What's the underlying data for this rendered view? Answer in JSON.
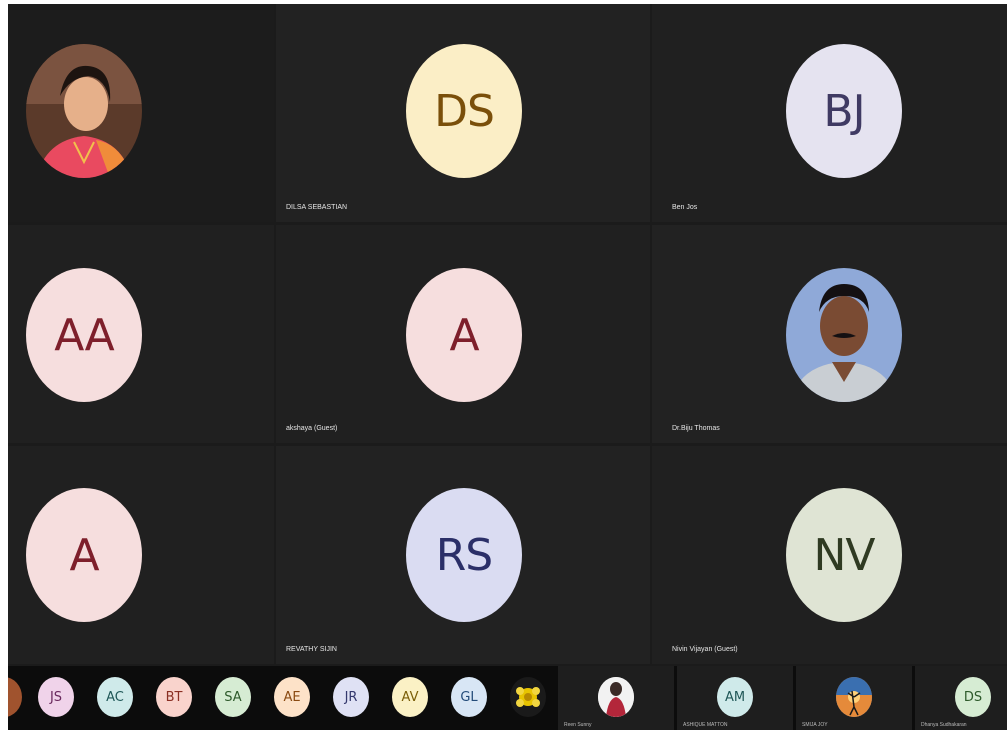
{
  "colors": {
    "stage_bg": "#1b1b1b",
    "tile_bg": "#202020",
    "strip_bg": "#0c0c0c"
  },
  "tiles": [
    {
      "id": "photo-woman",
      "initials": "",
      "name": "",
      "avatar_type": "photo",
      "avatar_bg": "#8a5a3c",
      "text_color": ""
    },
    {
      "id": "dilsa",
      "initials": "DS",
      "name": "DILSA SEBASTIAN",
      "avatar_type": "initials",
      "avatar_bg": "#fbeec6",
      "text_color": "#7a4f0a"
    },
    {
      "id": "ben",
      "initials": "BJ",
      "name": "Ben Jos",
      "avatar_type": "initials",
      "avatar_bg": "#e5e3f0",
      "text_color": "#3f3a63"
    },
    {
      "id": "aa",
      "initials": "AA",
      "name": "",
      "avatar_type": "initials",
      "avatar_bg": "#f6dede",
      "text_color": "#7e1f2b"
    },
    {
      "id": "akshaya",
      "initials": "A",
      "name": "akshaya (Guest)",
      "avatar_type": "initials",
      "avatar_bg": "#f6dede",
      "text_color": "#7e1f2b"
    },
    {
      "id": "biju",
      "initials": "",
      "name": "Dr.Biju Thomas",
      "avatar_type": "photo",
      "avatar_bg": "#8fa9d8",
      "text_color": ""
    },
    {
      "id": "a2",
      "initials": "A",
      "name": "",
      "avatar_type": "initials",
      "avatar_bg": "#f6dede",
      "text_color": "#7e1f2b"
    },
    {
      "id": "revathy",
      "initials": "RS",
      "name": "REVATHY SIJIN",
      "avatar_type": "initials",
      "avatar_bg": "#dadcf2",
      "text_color": "#2b2f68"
    },
    {
      "id": "nivin",
      "initials": "NV",
      "name": "Nivin Vijayan (Guest)",
      "avatar_type": "initials",
      "avatar_bg": "#dfe4d4",
      "text_color": "#2f3a22"
    }
  ],
  "strip": {
    "minis": [
      {
        "initials": "",
        "bg": "#a0532e",
        "fg": "#ffffff",
        "kind": "photo-partial"
      },
      {
        "initials": "JS",
        "bg": "#f0d3ea",
        "fg": "#6a2a5e",
        "kind": "initials"
      },
      {
        "initials": "AC",
        "bg": "#cfeaea",
        "fg": "#1f5757",
        "kind": "initials"
      },
      {
        "initials": "BT",
        "bg": "#f9d3cc",
        "fg": "#8a2f23",
        "kind": "initials"
      },
      {
        "initials": "SA",
        "bg": "#d6ecd3",
        "fg": "#2e5a2b",
        "kind": "initials"
      },
      {
        "initials": "AE",
        "bg": "#fde2c8",
        "fg": "#8a4a12",
        "kind": "initials"
      },
      {
        "initials": "JR",
        "bg": "#dfe1f4",
        "fg": "#34386d",
        "kind": "initials"
      },
      {
        "initials": "AV",
        "bg": "#fbf1c5",
        "fg": "#7a5d07",
        "kind": "initials"
      },
      {
        "initials": "GL",
        "bg": "#d8e6f5",
        "fg": "#244c7a",
        "kind": "initials"
      },
      {
        "initials": "",
        "bg": "#e8c400",
        "fg": "#000000",
        "kind": "photo-flower"
      }
    ],
    "tiles": [
      {
        "initials": "",
        "name": "Reen Sunny",
        "bg": "#5a2a2a",
        "fg": "#ffffff",
        "kind": "photo"
      },
      {
        "initials": "AM",
        "name": "ASHIQUE MATTON",
        "bg": "#cfeaea",
        "fg": "#1f5757",
        "kind": "initials"
      },
      {
        "initials": "",
        "name": "SMIJA JOY",
        "bg": "#d98a4a",
        "fg": "#ffffff",
        "kind": "photo"
      },
      {
        "initials": "DS",
        "name": "Dhanya Sudhakaran",
        "bg": "#d6ecd3",
        "fg": "#2e5a2b",
        "kind": "initials"
      }
    ]
  }
}
